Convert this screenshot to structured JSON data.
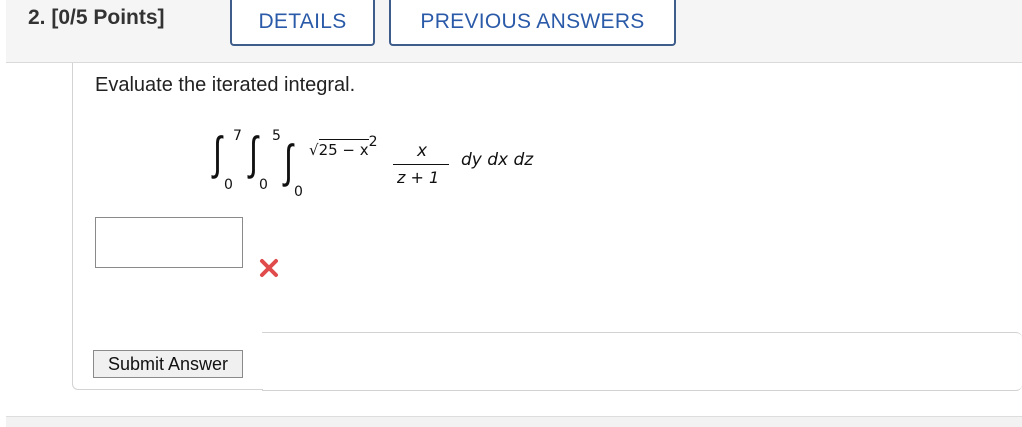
{
  "header": {
    "question_title": "2. [0/5 Points]",
    "details_label": "DETAILS",
    "previous_answers_label": "PREVIOUS ANSWERS"
  },
  "question": {
    "prompt": "Evaluate the iterated integral.",
    "integral": {
      "outer_upper": "7",
      "outer_lower": "0",
      "middle_upper": "5",
      "middle_lower": "0",
      "inner_upper_radicand": "25 − x",
      "inner_upper_exponent": "2",
      "inner_lower": "0",
      "numerator": "x",
      "denominator": "z + 1",
      "differentials": "dy dx dz"
    }
  },
  "answer": {
    "value": "",
    "status": "incorrect",
    "status_icon": "red-x-icon",
    "status_color": "#e04b4b"
  },
  "submit_label": "Submit Answer"
}
